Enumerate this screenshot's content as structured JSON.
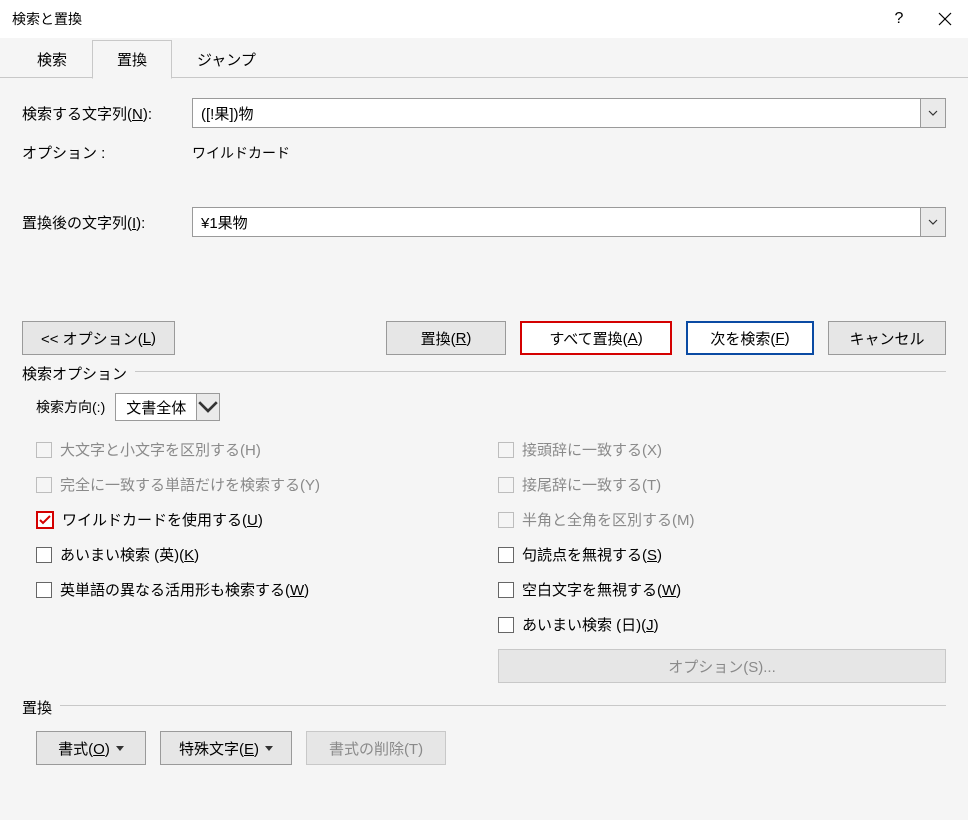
{
  "titlebar": {
    "title": "検索と置換"
  },
  "tabs": {
    "search": "検索",
    "replace": "置換",
    "jump": "ジャンプ",
    "active": "replace"
  },
  "fields": {
    "find_label_pre": "検索する文字列(",
    "find_label_key": "N",
    "find_label_post": "):",
    "find_value": "([!果])物",
    "option_label": "オプション :",
    "option_value": "ワイルドカード",
    "replace_label_pre": "置換後の文字列(",
    "replace_label_key": "I",
    "replace_label_post": "):",
    "replace_value": "¥1果物"
  },
  "buttons": {
    "options_pre": "<< オプション(",
    "options_key": "L",
    "options_post": ")",
    "replace_pre": "置換(",
    "replace_key": "R",
    "replace_post": ")",
    "replace_all_pre": "すべて置換(",
    "replace_all_key": "A",
    "replace_all_post": ")",
    "find_next_pre": "次を検索(",
    "find_next_key": "F",
    "find_next_post": ")",
    "cancel": "キャンセル"
  },
  "group": {
    "legend": "検索オプション",
    "direction_label_pre": "検索方向(",
    "direction_label_key": ":",
    "direction_label_post": ")",
    "direction_value": "文書全体",
    "left": {
      "case": "大文字と小文字を区別する(H)",
      "whole": "完全に一致する単語だけを検索する(Y)",
      "wildcard_pre": "ワイルドカードを使用する(",
      "wildcard_key": "U",
      "wildcard_post": ")",
      "fuzzy_en_pre": "あいまい検索 (英)(",
      "fuzzy_en_key": "K",
      "fuzzy_en_post": ")",
      "forms_pre": "英単語の異なる活用形も検索する(",
      "forms_key": "W",
      "forms_post": ")"
    },
    "right": {
      "prefix": "接頭辞に一致する(X)",
      "suffix": "接尾辞に一致する(T)",
      "width": "半角と全角を区別する(M)",
      "punct_pre": "句読点を無視する(",
      "punct_key": "S",
      "punct_post": ")",
      "white_pre": "空白文字を無視する(",
      "white_key": "W",
      "white_post": ")",
      "fuzzy_jp_pre": "あいまい検索 (日)(",
      "fuzzy_jp_key": "J",
      "fuzzy_jp_post": ")",
      "options_btn": "オプション(S)..."
    }
  },
  "replace_group": {
    "legend": "置換",
    "format_pre": "書式(",
    "format_key": "O",
    "format_post": ")",
    "special_pre": "特殊文字(",
    "special_key": "E",
    "special_post": ")",
    "clear_format": "書式の削除(T)"
  }
}
